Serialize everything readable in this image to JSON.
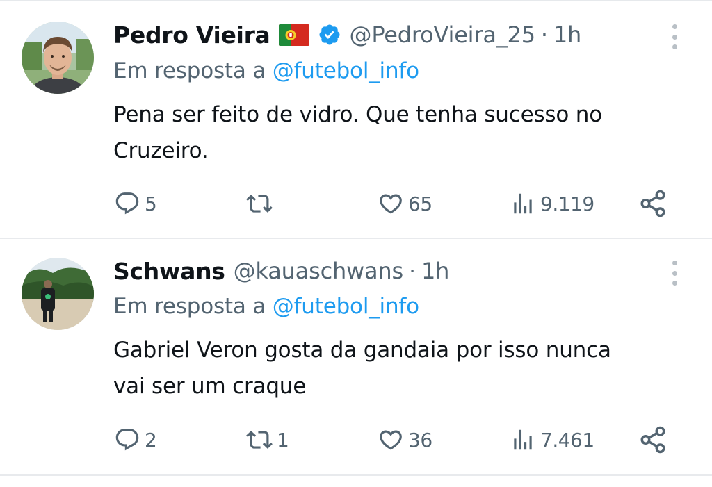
{
  "colors": {
    "text": "#0f1419",
    "secondary": "#536471",
    "link": "#1d9bf0",
    "verified": "#1d9bf0",
    "divider": "#e8eaed"
  },
  "tweets": [
    {
      "display_name": "Pedro Vieira",
      "flag_icon": "portugal-flag-icon",
      "verified": true,
      "handle": "@PedroVieira_25",
      "separator": "·",
      "time": "1h",
      "reply_prefix": "Em resposta a ",
      "reply_handle": "@futebol_info",
      "text": "Pena ser feito de vidro. Que tenha sucesso no\nCruzeiro.",
      "replies": "5",
      "retweets": "",
      "likes": "65",
      "views": "9.119"
    },
    {
      "display_name": "Schwans",
      "verified": false,
      "handle": "@kauaschwans",
      "separator": "·",
      "time": "1h",
      "reply_prefix": "Em resposta a ",
      "reply_handle": "@futebol_info",
      "text": "Gabriel Veron gosta da gandaia por isso nunca\nvai ser um craque",
      "replies": "2",
      "retweets": "1",
      "likes": "36",
      "views": "7.461"
    }
  ]
}
